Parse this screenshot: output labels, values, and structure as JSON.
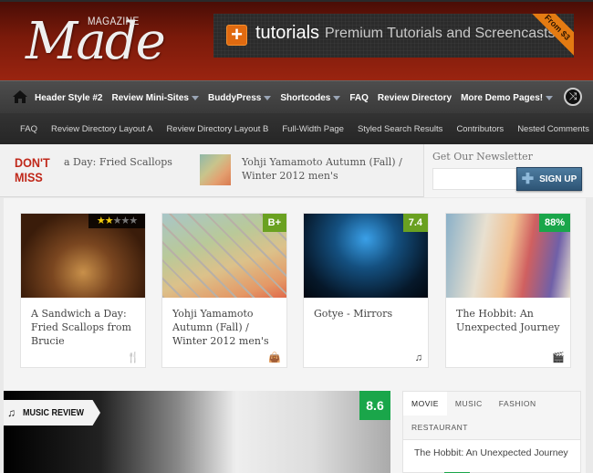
{
  "header": {
    "logo_small": "MAGAZINE",
    "logo_big": "Made",
    "banner": {
      "icon": "plus-icon",
      "brand": "tutorials",
      "tagline": "Premium Tutorials and Screencasts",
      "ribbon": "From $3"
    }
  },
  "main_nav": {
    "home_icon": "home-icon",
    "items": [
      {
        "label": "Header Style #2",
        "dropdown": false
      },
      {
        "label": "Review Mini-Sites",
        "dropdown": true
      },
      {
        "label": "BuddyPress",
        "dropdown": true
      },
      {
        "label": "Shortcodes",
        "dropdown": true
      },
      {
        "label": "FAQ",
        "dropdown": false
      },
      {
        "label": "Review Directory",
        "dropdown": false
      },
      {
        "label": "More Demo Pages!",
        "dropdown": true
      }
    ],
    "shuffle_icon": "shuffle-icon"
  },
  "sub_nav": {
    "items": [
      "FAQ",
      "Review Directory Layout A",
      "Review Directory Layout B",
      "Full-Width Page",
      "Styled Search Results",
      "Contributors",
      "Nested Comments"
    ]
  },
  "dont_miss": {
    "label_line1": "DON'T",
    "label_line2": "MISS",
    "ticker": [
      {
        "title": "a Day: Fried Scallops"
      },
      {
        "title": "Yohji Yamamoto Autumn (Fall) / Winter 2012 men's"
      }
    ]
  },
  "newsletter": {
    "title": "Get Our Newsletter",
    "email_value": "",
    "signup_label": "SIGN UP"
  },
  "cards": [
    {
      "title": "A Sandwich a Day: Fried Scallops from Brucie",
      "rating_stars": 2,
      "rating_max": 5,
      "category_icon": "restaurant-icon",
      "category_glyph": "🍴"
    },
    {
      "title": "Yohji Yamamoto Autumn (Fall) / Winter 2012 men's",
      "badge": "B+",
      "badge_color": "#6aa121",
      "category_icon": "shopping-bag-icon",
      "category_glyph": "👜"
    },
    {
      "title": "Gotye - Mirrors",
      "badge": "7.4",
      "badge_color": "#6aa121",
      "category_icon": "music-note-icon",
      "category_glyph": "♫"
    },
    {
      "title": "The Hobbit: An Unexpected Journey",
      "badge": "88%",
      "badge_color": "#1aa64a",
      "category_icon": "clapperboard-icon",
      "category_glyph": "🎬"
    }
  ],
  "feature": {
    "category_icon": "music-note-icon",
    "category_glyph": "♫",
    "category": "MUSIC REVIEW",
    "score": "8.6",
    "score_color": "#1aa64a"
  },
  "review_tabs": {
    "tabs": [
      {
        "label": "MOVIE",
        "active": true
      },
      {
        "label": "MUSIC",
        "active": false
      },
      {
        "label": "FASHION",
        "active": false
      },
      {
        "label": "RESTAURANT",
        "active": false
      }
    ],
    "entries": [
      "The Hobbit: An Unexpected Journey"
    ]
  }
}
